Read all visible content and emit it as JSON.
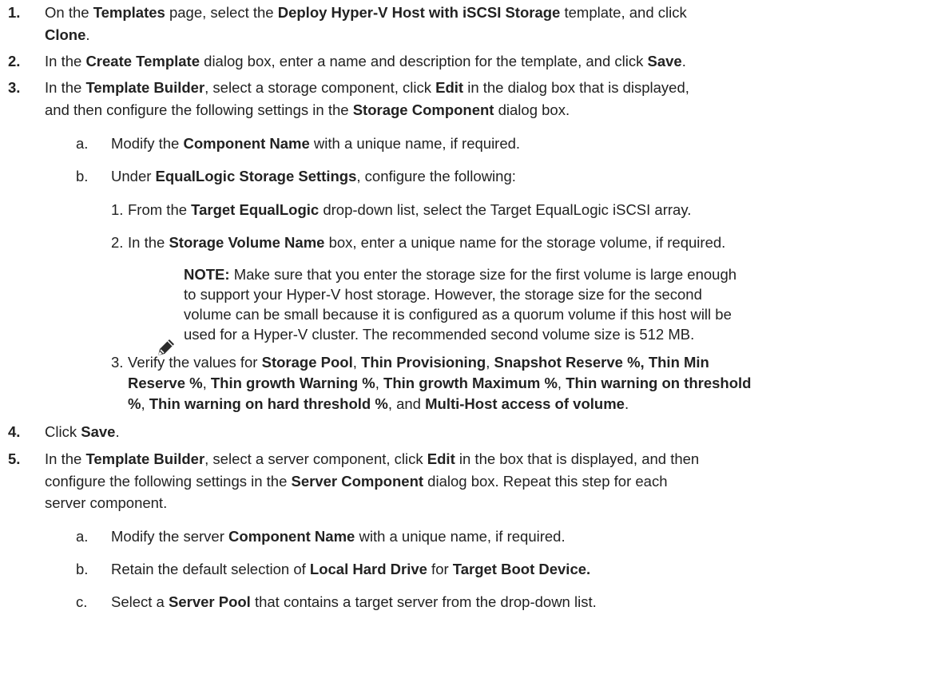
{
  "doc": {
    "step1": {
      "num": "1.",
      "l1": {
        "t1": "On the ",
        "b1": "Templates",
        "t2": " page, select the ",
        "b2": "Deploy Hyper-V Host with iSCSI Storage",
        "t3": " template, and click"
      },
      "l2": {
        "b1": "Clone",
        "t1": "."
      }
    },
    "step2": {
      "num": "2.",
      "l1": {
        "t1": "In the ",
        "b1": "Create Template",
        "t2": " dialog box, enter a name and description for the template, and click ",
        "b2": "Save",
        "t3": "."
      }
    },
    "step3": {
      "num": "3.",
      "l1": {
        "t1": "In the ",
        "b1": "Template Builder",
        "t2": ", select a storage component, click ",
        "b2": "Edit",
        "t3": " in the dialog box that is displayed,"
      },
      "l2": {
        "t1": "and then configure the following settings in the ",
        "b1": "Storage Component",
        "t2": " dialog box."
      },
      "a": {
        "label": "a.",
        "t1": "Modify the ",
        "b1": "Component Name",
        "t2": " with a unique name, if required."
      },
      "b": {
        "label": "b.",
        "t1": "Under ",
        "b1": "EqualLogic Storage Settings",
        "t2": ", configure the following:"
      },
      "s1": {
        "label": "1.",
        "t1": "From the ",
        "b1": "Target EqualLogic",
        "t2": " drop-down list, select the Target EqualLogic iSCSI array."
      },
      "s2": {
        "label": "2.",
        "t1": "In the ",
        "b1": "Storage Volume Name",
        "t2": " box, enter a unique name for the storage volume, if required."
      },
      "note": {
        "icon": "pencil-note-icon",
        "l1_bold": "NOTE:",
        "l1": " Make sure that you enter the storage size for the first volume is large enough",
        "l2": "to support your Hyper-V host storage. However, the storage size for the second",
        "l3": "volume can be small because it is configured as a quorum volume if this host will be",
        "l4": "used for a Hyper-V cluster. The recommended second volume size is 512 MB."
      },
      "s3": {
        "label": "3.",
        "l1": {
          "t1": "Verify the values for ",
          "b1": "Storage Pool",
          "t2": ", ",
          "b2": "Thin Provisioning",
          "t3": ", ",
          "b3": "Snapshot Reserve %, Thin Min"
        },
        "l2": {
          "b1": "Reserve %",
          "t1": ", ",
          "b2": "Thin growth Warning %",
          "t2": ", ",
          "b3": "Thin growth Maximum %",
          "t3": ", ",
          "b4": "Thin warning on threshold"
        },
        "l3": {
          "b1": "%",
          "t1": ", ",
          "b2": "Thin warning on hard threshold %",
          "t2": ", and ",
          "b3": "Multi-Host access of volume",
          "t3": "."
        }
      }
    },
    "step4": {
      "num": "4.",
      "t1": "Click ",
      "b1": "Save",
      "t2": "."
    },
    "step5": {
      "num": "5.",
      "l1": {
        "t1": "In the ",
        "b1": "Template Builder",
        "t2": ", select a server component, click ",
        "b2": "Edit",
        "t3": " in the box that is displayed, and then"
      },
      "l2": {
        "t1": "configure the following settings in the ",
        "b1": "Server Component",
        "t2": " dialog box. Repeat this step for each"
      },
      "l3": {
        "t1": "server component."
      },
      "a": {
        "label": "a.",
        "t1": "Modify the server ",
        "b1": "Component Name",
        "t2": " with a unique name, if required."
      },
      "b": {
        "label": "b.",
        "t1": "Retain the default selection of ",
        "b1": "Local Hard Drive",
        "t2": " for ",
        "b2": "Target Boot Device."
      },
      "c": {
        "label": "c.",
        "t1": "Select a ",
        "b1": "Server Pool",
        "t2": " that contains a target server from the drop-down list."
      }
    }
  }
}
